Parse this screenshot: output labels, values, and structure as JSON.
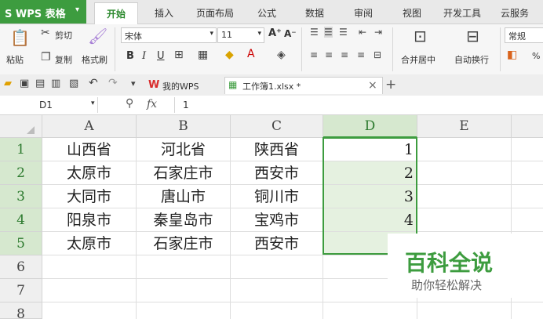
{
  "app": {
    "logo": "S WPS 表格",
    "logo_arrow": "▾"
  },
  "menu": {
    "active": "开始",
    "items": [
      "插入",
      "页面布局",
      "公式",
      "数据",
      "审阅",
      "视图",
      "开发工具",
      "云服务"
    ]
  },
  "ribbon": {
    "paste": "粘贴",
    "cut": "剪切",
    "copy": "复制",
    "format_painter": "格式刷",
    "font_name": "宋体",
    "font_size": "11",
    "bold": "B",
    "italic": "I",
    "underline": "U",
    "grow": "A⁺",
    "shrink": "A⁻",
    "merge": "合并居中",
    "wrap": "自动换行",
    "numfmt": "常规",
    "percent": "%"
  },
  "tabs": [
    {
      "label": "我的WPS",
      "logo": "W"
    },
    {
      "label": "工作簿1.xlsx *"
    }
  ],
  "tab_close": "×",
  "tab_add": "+",
  "formula_bar": {
    "name_box": "D1",
    "fx": "fx",
    "value": "1"
  },
  "sheet": {
    "columns": [
      "A",
      "B",
      "C",
      "D",
      "E"
    ],
    "rows": [
      "1",
      "2",
      "3",
      "4",
      "5",
      "6",
      "7",
      "8"
    ],
    "cells": [
      [
        "山西省",
        "河北省",
        "陕西省",
        "1"
      ],
      [
        "太原市",
        "石家庄市",
        "西安市",
        "2"
      ],
      [
        "大同市",
        "唐山市",
        "铜川市",
        "3"
      ],
      [
        "阳泉市",
        "秦皇岛市",
        "宝鸡市",
        "4"
      ],
      [
        "太原市",
        "石家庄市",
        "西安市",
        ""
      ]
    ]
  },
  "watermark": {
    "title": "百科全说",
    "subtitle": "助你轻松解决"
  },
  "colors": {
    "accent": "#3d9c3f",
    "selection": "#e5f1e0"
  }
}
